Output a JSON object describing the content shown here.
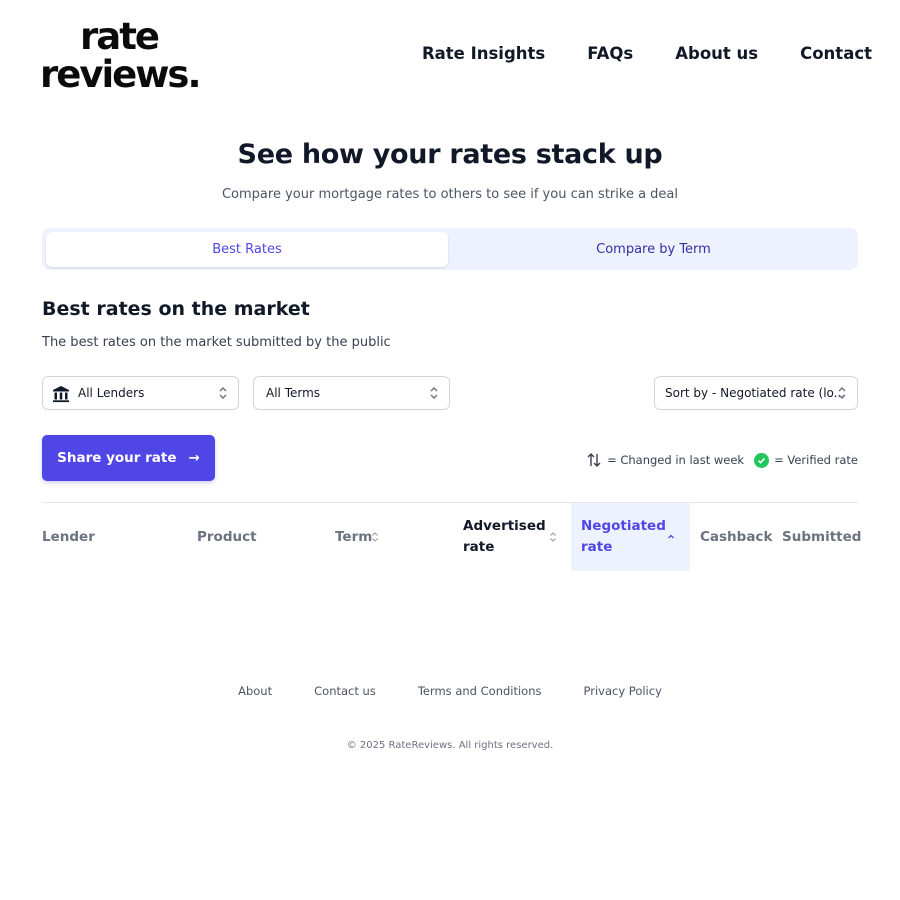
{
  "logo": {
    "line1": "rate",
    "line2": "reviews."
  },
  "nav": {
    "items": [
      "Rate Insights",
      "FAQs",
      "About us",
      "Contact"
    ]
  },
  "hero": {
    "title": "See how your rates stack up",
    "subtitle": "Compare your mortgage rates to others to see if you can strike a deal"
  },
  "tabs": [
    {
      "label": "Best Rates",
      "active": true
    },
    {
      "label": "Compare by Term",
      "active": false
    }
  ],
  "section": {
    "title": "Best rates on the market",
    "subtitle": "The best rates on the market submitted by the public"
  },
  "filters": {
    "lender": "All Lenders",
    "term": "All Terms",
    "sort": "Sort by - Negotiated rate (lo..."
  },
  "share_button": {
    "label": "Share your rate",
    "arrow": "→"
  },
  "legend": {
    "changed": "= Changed in last week",
    "verified": "= Verified rate",
    "verified_color": "#22c55e"
  },
  "table": {
    "columns": [
      "Lender",
      "Product",
      "Term",
      "Advertised rate",
      "Negotiated rate",
      "Cashback",
      "Submitted"
    ],
    "active_sort": "Negotiated rate",
    "rows": []
  },
  "footer": {
    "links": [
      "About",
      "Contact us",
      "Terms and Conditions",
      "Privacy Policy"
    ],
    "copyright": "© 2025 RateReviews. All rights reserved."
  },
  "colors": {
    "accent": "#4f46e5",
    "accent_light": "#eef1fe",
    "text": "#111827"
  }
}
